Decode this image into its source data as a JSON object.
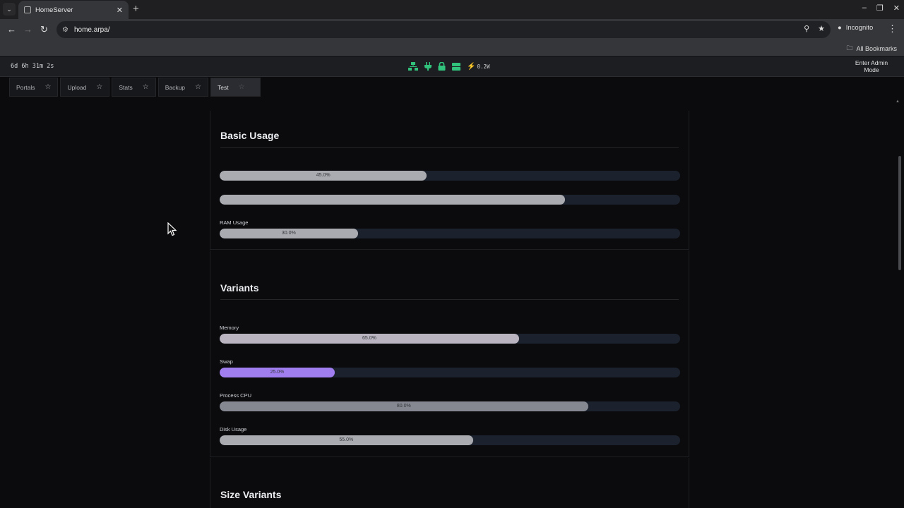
{
  "browser": {
    "tab_title": "HomeServer",
    "url": "home.arpa/",
    "incognito_label": "Incognito",
    "bookmarks_label": "All Bookmarks"
  },
  "header": {
    "uptime": "6d 6h 31m 2s",
    "power": "0.2W",
    "admin_button": "Enter Admin Mode",
    "status_icons": [
      "network-icon",
      "plug-icon",
      "lock-icon",
      "storage-icon",
      "bolt-icon"
    ],
    "status_color": "#31c27c"
  },
  "tabs": [
    {
      "label": "Portals",
      "active": false
    },
    {
      "label": "Upload",
      "active": false
    },
    {
      "label": "Stats",
      "active": false
    },
    {
      "label": "Backup",
      "active": false
    },
    {
      "label": "Test",
      "active": true
    }
  ],
  "basic_usage": {
    "title": "Basic Usage",
    "bars": [
      {
        "label": "",
        "value": 45,
        "text": "45.0%",
        "color": "#a9abb0"
      },
      {
        "label": "",
        "value": 75,
        "text": "",
        "color": "#a9abb0"
      },
      {
        "label": "RAM Usage",
        "value": 30,
        "text": "30.0%",
        "color": "#a9abb0"
      }
    ]
  },
  "variants": {
    "title": "Variants",
    "bars": [
      {
        "label": "Memory",
        "value": 65,
        "text": "65.0%",
        "color": "#b9b4bf"
      },
      {
        "label": "Swap",
        "value": 25,
        "text": "25.0%",
        "color": "#a07ef0"
      },
      {
        "label": "Process CPU",
        "value": 80,
        "text": "80.0%",
        "color": "#858890"
      },
      {
        "label": "Disk Usage",
        "value": 55,
        "text": "55.0%",
        "color": "#a9abb0"
      }
    ]
  },
  "size_variants": {
    "title": "Size Variants"
  }
}
